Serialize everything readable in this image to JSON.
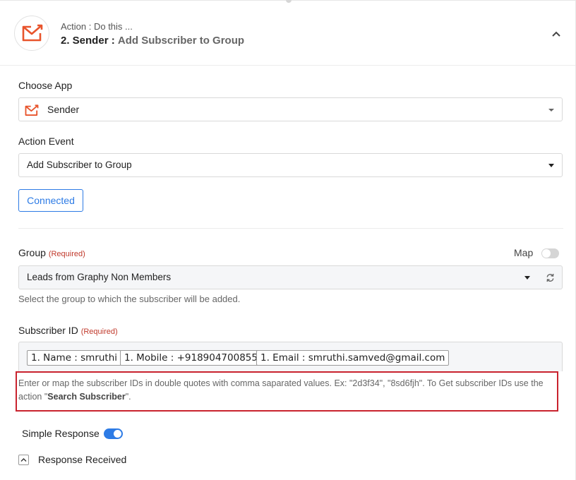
{
  "header": {
    "subtitle": "Action : Do this ...",
    "step": "2. Sender :",
    "action": "Add Subscriber to Group"
  },
  "choose_app": {
    "label": "Choose App",
    "value": "Sender",
    "icon": "sender-logo-icon"
  },
  "action_event": {
    "label": "Action Event",
    "value": "Add Subscriber to Group"
  },
  "connection": {
    "label": "Connected"
  },
  "group": {
    "label": "Group",
    "required": "(Required)",
    "map_label": "Map",
    "value": "Leads from Graphy Non Members",
    "help": "Select the group to which the subscriber will be added."
  },
  "subscriber_id": {
    "label": "Subscriber ID",
    "required": "(Required)",
    "tags": [
      "1. Name : smruthi",
      "1. Mobile : +918904700855",
      "1. Email : smruthi.samved@gmail.com"
    ],
    "help_pre": "Enter or map the subscriber IDs in double quotes with comma saparated values. Ex: \"2d3f34\", \"8sd6fjh\". To Get subscriber IDs use the action \"",
    "help_bold": "Search Subscriber",
    "help_post": "\"."
  },
  "simple_response": {
    "label": "Simple Response",
    "enabled": true
  },
  "response_received": {
    "label": "Response Received"
  },
  "colors": {
    "accent": "#2d7be5",
    "sender_orange": "#e8542c",
    "highlight_red": "#c9232e",
    "required_red": "#c0392b"
  }
}
